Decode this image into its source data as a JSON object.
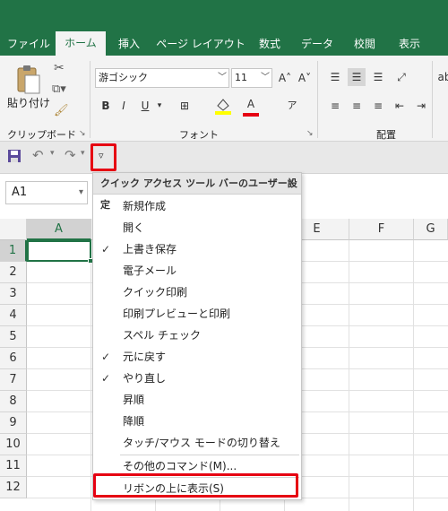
{
  "tabs": [
    {
      "label": "ファイル",
      "active": false
    },
    {
      "label": "ホーム",
      "active": true
    },
    {
      "label": "挿入",
      "active": false
    },
    {
      "label": "ページ レイアウト",
      "active": false
    },
    {
      "label": "数式",
      "active": false
    },
    {
      "label": "データ",
      "active": false
    },
    {
      "label": "校閲",
      "active": false
    },
    {
      "label": "表示",
      "active": false
    }
  ],
  "ribbon": {
    "paste_label": "貼り付け",
    "clipboard_label": "クリップボード",
    "font_name": "游ゴシック",
    "font_size": "11",
    "font_label": "フォント",
    "align_label": "配置",
    "bold": "B",
    "italic": "I",
    "underline": "U",
    "grow_font": "A˄",
    "shrink_font": "A˅",
    "font_color_glyph": "A"
  },
  "namebox": {
    "value": "A1"
  },
  "grid": {
    "columns": [
      "A",
      "B",
      "C",
      "D",
      "E",
      "F",
      "G"
    ],
    "rows": [
      "1",
      "2",
      "3",
      "4",
      "5",
      "6",
      "7",
      "8",
      "9",
      "10",
      "11",
      "12"
    ],
    "selected_cell": "A1"
  },
  "menu": {
    "title": "クイック アクセス ツール バーのユーザー設定",
    "items": [
      {
        "label": "新規作成",
        "checked": false
      },
      {
        "label": "開く",
        "checked": false
      },
      {
        "label": "上書き保存",
        "checked": true
      },
      {
        "label": "電子メール",
        "checked": false
      },
      {
        "label": "クイック印刷",
        "checked": false
      },
      {
        "label": "印刷プレビューと印刷",
        "checked": false
      },
      {
        "label": "スペル チェック",
        "checked": false
      },
      {
        "label": "元に戻す",
        "checked": true
      },
      {
        "label": "やり直し",
        "checked": true
      },
      {
        "label": "昇順",
        "checked": false
      },
      {
        "label": "降順",
        "checked": false
      },
      {
        "label": "タッチ/マウス モードの切り替え",
        "checked": false
      }
    ],
    "more_commands": "その他のコマンド(M)...",
    "show_above_ribbon": "リボンの上に表示(S)"
  },
  "colors": {
    "excel_green": "#217346",
    "highlight_red": "#e60012"
  }
}
